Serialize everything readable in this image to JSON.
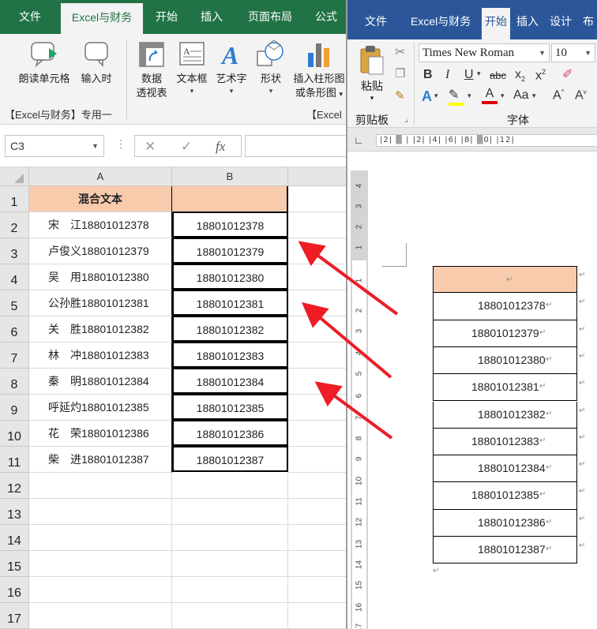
{
  "excel": {
    "tabs": [
      "文件",
      "Excel与财务",
      "开始",
      "插入",
      "页面布局",
      "公式"
    ],
    "active_tab": "Excel与财务",
    "ribbon": {
      "read_cell": "朗读单元格",
      "input_time": "输入时",
      "pivot_line1": "数据",
      "pivot_line2": "透视表",
      "textbox": "文本框",
      "wordart": "艺术字",
      "shapes": "形状",
      "chart_line1": "插入柱形图",
      "chart_line2": "或条形图",
      "group1": "【Excel与财务】专用一",
      "group2": "【Excel"
    },
    "name_box": "C3",
    "fx": "fx",
    "columns": [
      "A",
      "B"
    ],
    "rows": [
      "1",
      "2",
      "3",
      "4",
      "5",
      "6",
      "7",
      "8",
      "9",
      "10",
      "11",
      "12",
      "13",
      "14",
      "15",
      "16",
      "17"
    ],
    "header_a": "混合文本",
    "header_b": "",
    "col_a": [
      "宋　江18801012378",
      "卢俊义18801012379",
      "吴　用18801012380",
      "公孙胜18801012381",
      "关　胜18801012382",
      "林　冲18801012383",
      "秦　明18801012384",
      "呼延灼18801012385",
      "花　荣18801012386",
      "柴　进18801012387"
    ],
    "col_b": [
      "18801012378",
      "18801012379",
      "18801012380",
      "18801012381",
      "18801012382",
      "18801012383",
      "18801012384",
      "18801012385",
      "18801012386",
      "18801012387"
    ]
  },
  "word": {
    "tabs": [
      "文件",
      "Excel与财务",
      "开始",
      "插入",
      "设计",
      "布局"
    ],
    "active_tab": "开始",
    "font_name": "Times New Roman",
    "font_size": "10",
    "paste": "粘贴",
    "clipboard": "剪贴板",
    "font_group": "字体",
    "ruler_text": "|2|  ▒  |  |2|  |4|  |6|  |8|   ▒0|  |12|",
    "vruler": [
      "4",
      "3",
      "2",
      "1",
      "1",
      "2",
      "3",
      "4",
      "5",
      "6",
      "7",
      "8",
      "9",
      "10",
      "11",
      "12",
      "13",
      "14",
      "15",
      "16",
      "17"
    ],
    "table_values": [
      "18801012378",
      "18801012379",
      "18801012380",
      "18801012381",
      "18801012382",
      "18801012383",
      "18801012384",
      "18801012385",
      "18801012386",
      "18801012387"
    ],
    "header_mark": "↵",
    "cell_mark": "↵"
  },
  "colors": {
    "excel_green": "#217346",
    "word_blue": "#2b579a",
    "header_fill": "#f8cbad",
    "arrow_red": "#ee1c25"
  }
}
